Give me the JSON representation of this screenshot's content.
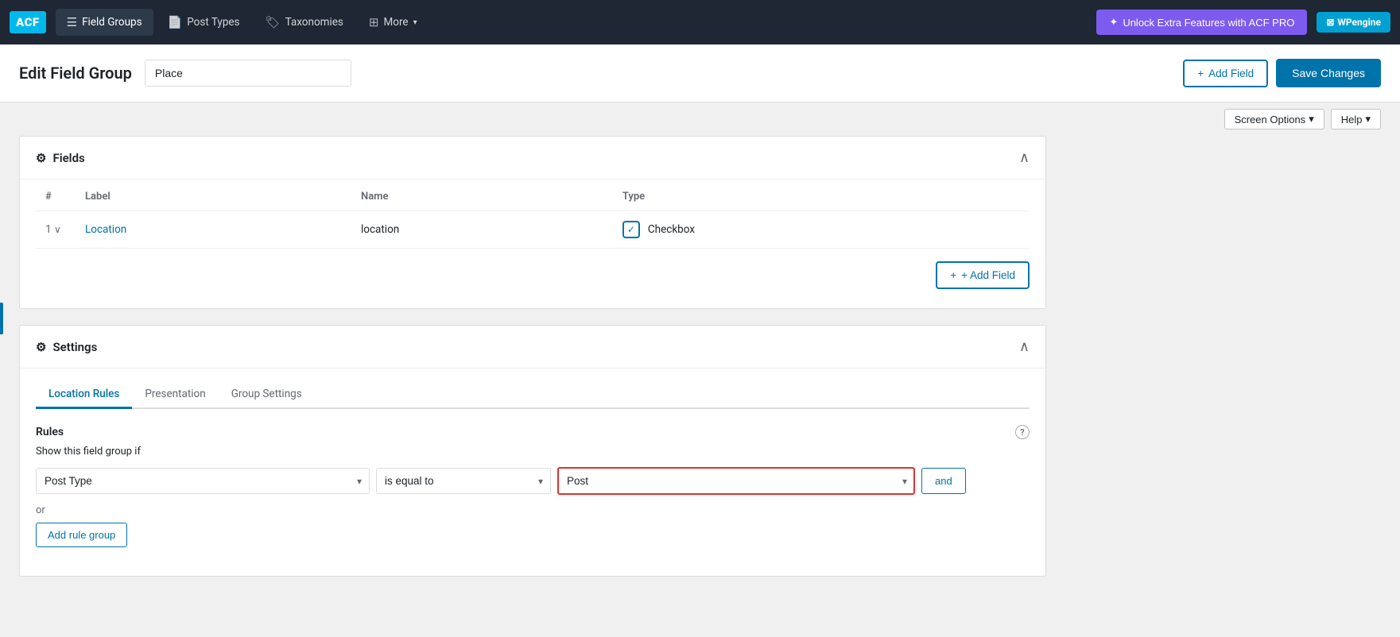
{
  "nav": {
    "logo": "ACF",
    "items": [
      {
        "id": "field-groups",
        "label": "Field Groups",
        "icon": "☰",
        "active": true
      },
      {
        "id": "post-types",
        "label": "Post Types",
        "icon": "📄"
      },
      {
        "id": "taxonomies",
        "label": "Taxonomies",
        "icon": "🏷"
      },
      {
        "id": "more",
        "label": "More",
        "icon": "⊞",
        "hasDropdown": true
      }
    ],
    "unlock_btn": "Unlock Extra Features with ACF PRO",
    "wp_engine_label": "WPengine"
  },
  "page_header": {
    "title": "Edit Field Group",
    "field_group_name": "Place",
    "add_field_label": "+ Add Field",
    "save_changes_label": "Save Changes"
  },
  "sub_header": {
    "screen_options": "Screen Options",
    "help": "Help"
  },
  "fields_panel": {
    "title": "Fields",
    "columns": {
      "num": "#",
      "label": "Label",
      "name": "Name",
      "type": "Type"
    },
    "rows": [
      {
        "num": "1",
        "label": "Location",
        "name": "location",
        "type": "Checkbox"
      }
    ],
    "add_field_label": "+ Add Field"
  },
  "settings_panel": {
    "title": "Settings",
    "tabs": [
      {
        "id": "location-rules",
        "label": "Location Rules",
        "active": true
      },
      {
        "id": "presentation",
        "label": "Presentation",
        "active": false
      },
      {
        "id": "group-settings",
        "label": "Group Settings",
        "active": false
      }
    ],
    "rules": {
      "label": "Rules",
      "show_if": "Show this field group if",
      "condition": {
        "post_type_value": "Post Type",
        "operator_value": "is equal to",
        "value_value": "Post"
      },
      "and_label": "and",
      "or_label": "or",
      "add_rule_group_label": "Add rule group"
    }
  }
}
